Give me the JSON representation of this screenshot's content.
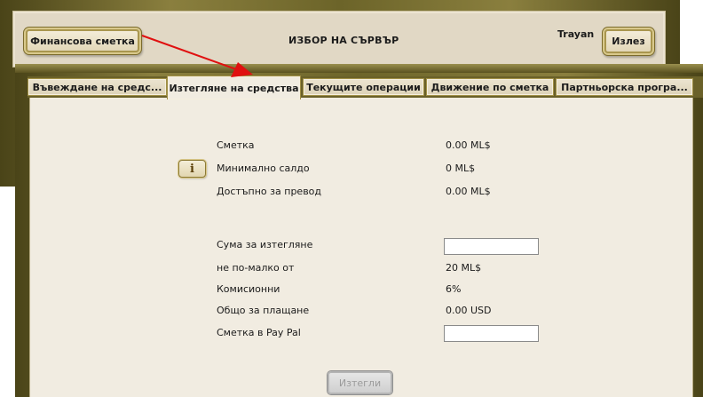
{
  "header": {
    "finance_button": "Финансова сметка",
    "server_title": "ИЗБОР НА СЪРВЪР",
    "username": "Trayan",
    "logout_button": "Излез"
  },
  "tabs": [
    {
      "label": "Въвеждане на средс...",
      "active": false
    },
    {
      "label": "Изтегляне на средства",
      "active": true
    },
    {
      "label": "Текущите операции",
      "active": false
    },
    {
      "label": "Движение по сметка",
      "active": false
    },
    {
      "label": "Партньорска програ...",
      "active": false
    }
  ],
  "balance": {
    "account_label": "Сметка",
    "account_value": "0.00 ML$",
    "min_balance_label": "Минимално салдо",
    "min_balance_value": "0 ML$",
    "available_label": "Достъпно за превод",
    "available_value": "0.00 ML$",
    "info_icon": "i"
  },
  "withdraw_form": {
    "amount_label": "Сума за изтегляне",
    "amount_value": "",
    "minimum_label": "не по-малко от",
    "minimum_value": "20 ML$",
    "commission_label": "Комисионни",
    "commission_value": "6%",
    "total_label": "Общо за плащане",
    "total_value": "0.00 USD",
    "paypal_label": "Сметка в Pay Pal",
    "paypal_value": "",
    "submit_button": "Изтегли"
  },
  "colors": {
    "frame_gold": "#8a7f3e",
    "panel_beige": "#e1d8c5",
    "content_bg": "#f1ece1",
    "arrow_red": "#e01010"
  }
}
